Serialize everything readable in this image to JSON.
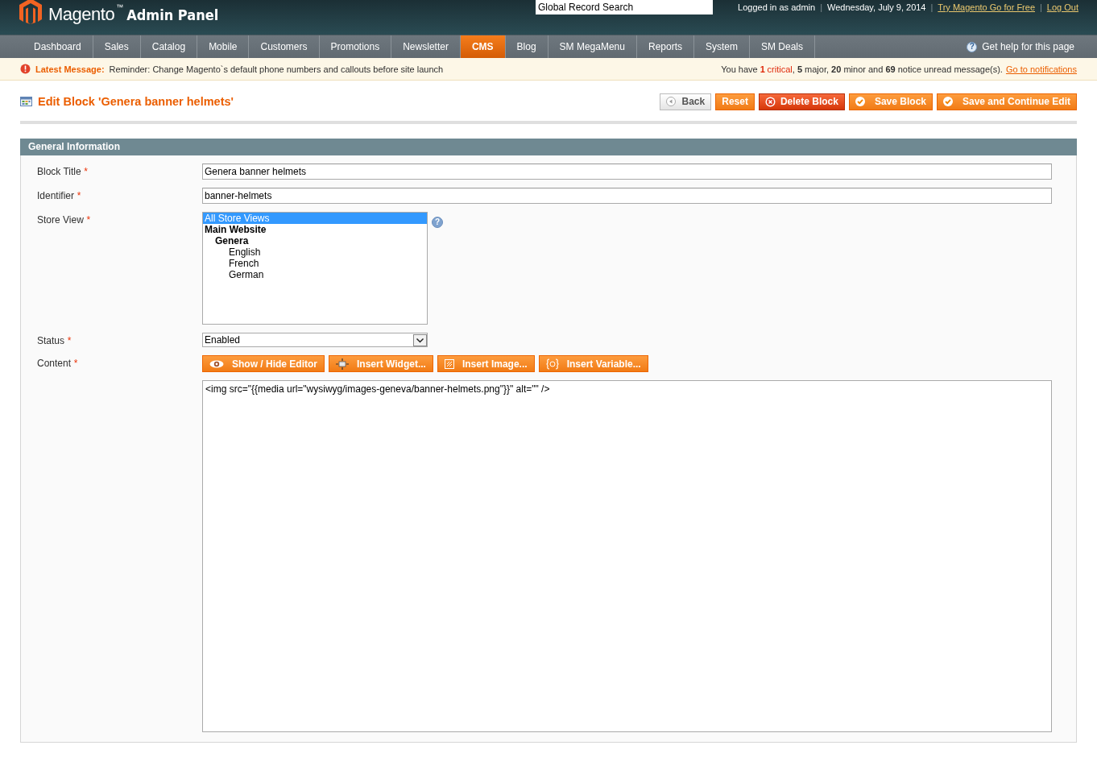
{
  "header": {
    "logo_text": "Magento",
    "logo_tm": "™",
    "logo_sub": "Admin Panel",
    "search": {
      "value": "Global Record Search"
    },
    "items": [
      {
        "kind": "text",
        "text": "Logged in as admin"
      },
      {
        "kind": "separator",
        "text": "|"
      },
      {
        "kind": "text",
        "text": "Wednesday, July 9, 2014"
      },
      {
        "kind": "separator",
        "text": "|"
      },
      {
        "kind": "link",
        "text": "Try Magento Go for Free"
      },
      {
        "kind": "separator",
        "text": "|"
      },
      {
        "kind": "link",
        "text": "Log Out"
      }
    ]
  },
  "nav": {
    "items": [
      {
        "label": "Dashboard",
        "selected": false
      },
      {
        "label": "Sales",
        "selected": false
      },
      {
        "label": "Catalog",
        "selected": false
      },
      {
        "label": "Mobile",
        "selected": false
      },
      {
        "label": "Customers",
        "selected": false
      },
      {
        "label": "Promotions",
        "selected": false
      },
      {
        "label": "Newsletter",
        "selected": false
      },
      {
        "label": "CMS",
        "selected": true
      },
      {
        "label": "Blog",
        "selected": false
      },
      {
        "label": "SM MegaMenu",
        "selected": false
      },
      {
        "label": "Reports",
        "selected": false
      },
      {
        "label": "System",
        "selected": false
      },
      {
        "label": "SM Deals",
        "selected": false
      }
    ],
    "help_icon": "?",
    "help": "Get help for this page"
  },
  "message": {
    "label": "Latest Message:",
    "text": "Reminder: Change Magento`s default phone numbers and callouts before site launch",
    "notice": [
      {
        "kind": "plain",
        "text": "You have "
      },
      {
        "kind": "critical",
        "text": "1"
      },
      {
        "kind": "critical-word",
        "text": "critical"
      },
      {
        "kind": "plain",
        "text": ", "
      },
      {
        "kind": "bold",
        "text": "5"
      },
      {
        "kind": "plain",
        "text": " major, "
      },
      {
        "kind": "bold",
        "text": "20"
      },
      {
        "kind": "plain",
        "text": " minor and "
      },
      {
        "kind": "bold",
        "text": "69"
      },
      {
        "kind": "plain",
        "text": " notice unread message(s)."
      }
    ],
    "link": "Go to notifications"
  },
  "page": {
    "title": "Edit Block 'Genera banner helmets'",
    "buttons": [
      {
        "label": "Back",
        "kind": "back"
      },
      {
        "label": "Reset",
        "kind": "plain"
      },
      {
        "label": "Delete Block",
        "kind": "delete"
      },
      {
        "label": "Save Block",
        "kind": "save"
      },
      {
        "label": "Save and Continue Edit",
        "kind": "save"
      }
    ]
  },
  "section": {
    "title": "General Information",
    "fields": [
      {
        "kind": "text",
        "label": "Block Title",
        "required_mark": "*",
        "value": "Genera banner helmets"
      },
      {
        "kind": "text",
        "label": "Identifier",
        "required_mark": "*",
        "value": "banner-helmets"
      },
      {
        "kind": "multiselect",
        "label": "Store View",
        "required_mark": "*",
        "help": "?",
        "options": [
          {
            "kind": "option",
            "label": "All Store Views",
            "selected": true
          },
          {
            "kind": "group",
            "label": "Main Website",
            "selected": false,
            "children": [
              {
                "kind": "group",
                "label": "Genera",
                "selected": false,
                "children": [
                  {
                    "kind": "option",
                    "label": "English",
                    "selected": false
                  },
                  {
                    "kind": "option",
                    "label": "French",
                    "selected": false
                  },
                  {
                    "kind": "option",
                    "label": "German",
                    "selected": false
                  }
                ]
              }
            ]
          }
        ]
      },
      {
        "kind": "select",
        "label": "Status",
        "required_mark": "*",
        "value": "Enabled"
      },
      {
        "kind": "editor",
        "label": "Content",
        "required_mark": "*",
        "buttons": [
          "Show / Hide Editor",
          "Insert Widget...",
          "Insert Image...",
          "Insert Variable..."
        ],
        "value": "<img src=\"{{media url=\"wysiwyg/images-geneva/banner-helmets.png\"}}\" alt=\"\" />"
      }
    ]
  }
}
